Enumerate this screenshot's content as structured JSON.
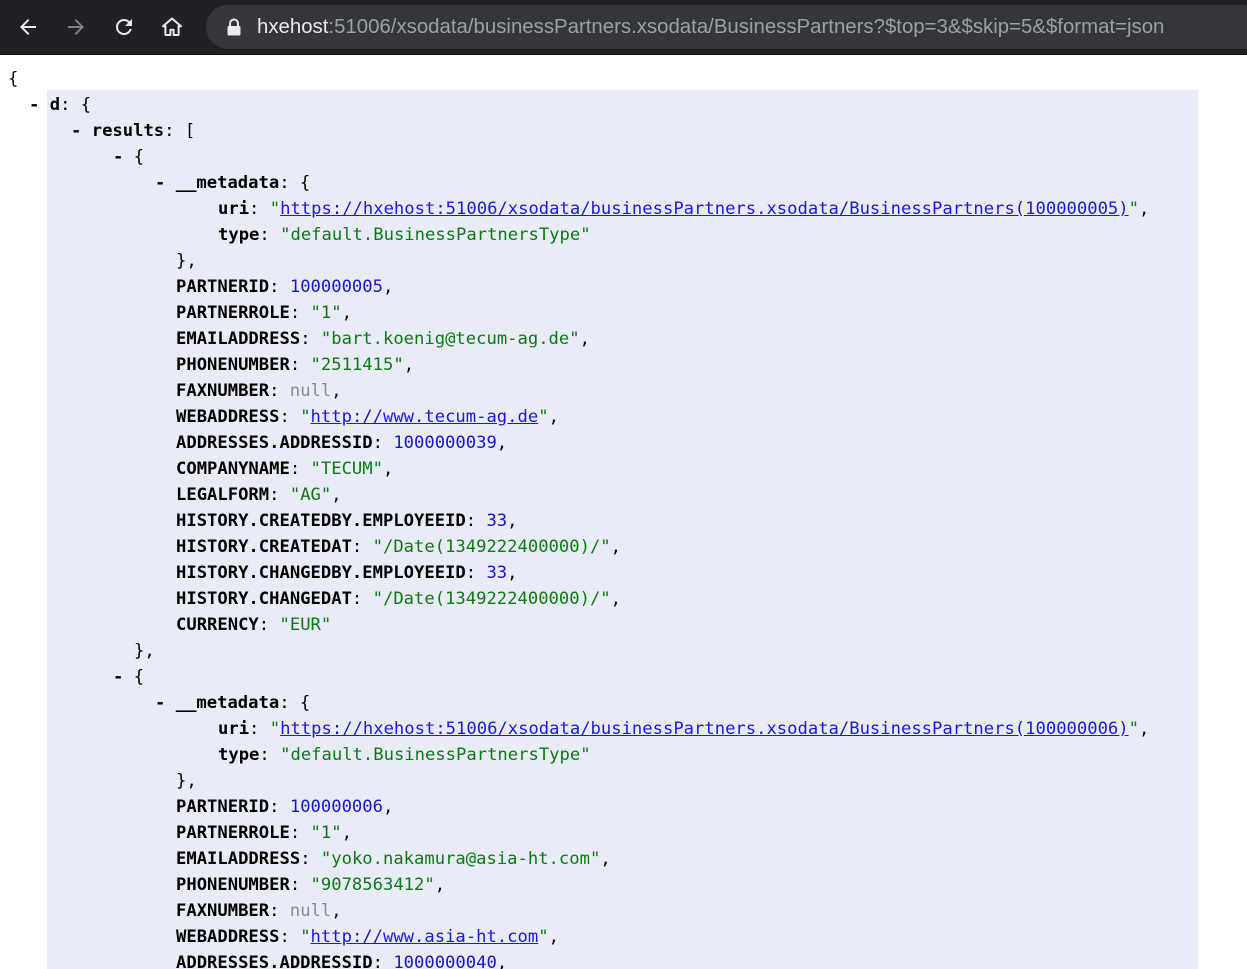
{
  "browser": {
    "url_host": "hxehost",
    "url_rest": ":51006/xsodata/businessPartners.xsodata/BusinessPartners?$top=3&$skip=5&$format=json"
  },
  "json": {
    "open_brace": "{",
    "toggle": "-",
    "d_key": "d",
    "results_key": "results",
    "metadata_key": "__metadata",
    "uri_key": "uri",
    "type_key": "type",
    "partnerid_key": "PARTNERID",
    "partnerrole_key": "PARTNERROLE",
    "email_key": "EMAILADDRESS",
    "phone_key": "PHONENUMBER",
    "fax_key": "FAXNUMBER",
    "web_key": "WEBADDRESS",
    "addressid_key": "ADDRESSES.ADDRESSID",
    "company_key": "COMPANYNAME",
    "legalform_key": "LEGALFORM",
    "createdby_key": "HISTORY.CREATEDBY.EMPLOYEEID",
    "createdat_key": "HISTORY.CREATEDAT",
    "changedby_key": "HISTORY.CHANGEDBY.EMPLOYEEID",
    "changedat_key": "HISTORY.CHANGEDAT",
    "currency_key": "CURRENCY",
    "records": [
      {
        "uri": "https://hxehost:51006/xsodata/businessPartners.xsodata/BusinessPartners(100000005)",
        "type": "default.BusinessPartnersType",
        "partnerid": "100000005",
        "partnerrole": "1",
        "email": "bart.koenig@tecum-ag.de",
        "phone": "2511415",
        "fax": "null",
        "web": "http://www.tecum-ag.de",
        "addressid": "1000000039",
        "company": "TECUM",
        "legalform": "AG",
        "createdby": "33",
        "createdat": "/Date(1349222400000)/",
        "changedby": "33",
        "changedat": "/Date(1349222400000)/",
        "currency": "EUR"
      },
      {
        "uri": "https://hxehost:51006/xsodata/businessPartners.xsodata/BusinessPartners(100000006)",
        "type": "default.BusinessPartnersType",
        "partnerid": "100000006",
        "partnerrole": "1",
        "email": "yoko.nakamura@asia-ht.com",
        "phone": "9078563412",
        "fax": "null",
        "web": "http://www.asia-ht.com",
        "addressid": "1000000040"
      }
    ]
  },
  "colors": {
    "toolbar_bg": "#202124",
    "omnibox_bg": "#35363a",
    "viewer_highlight": "#e9ebf7",
    "string": "#0a7b12",
    "number": "#1515d4",
    "null": "#8a8a8a",
    "link": "#1a1adc"
  }
}
